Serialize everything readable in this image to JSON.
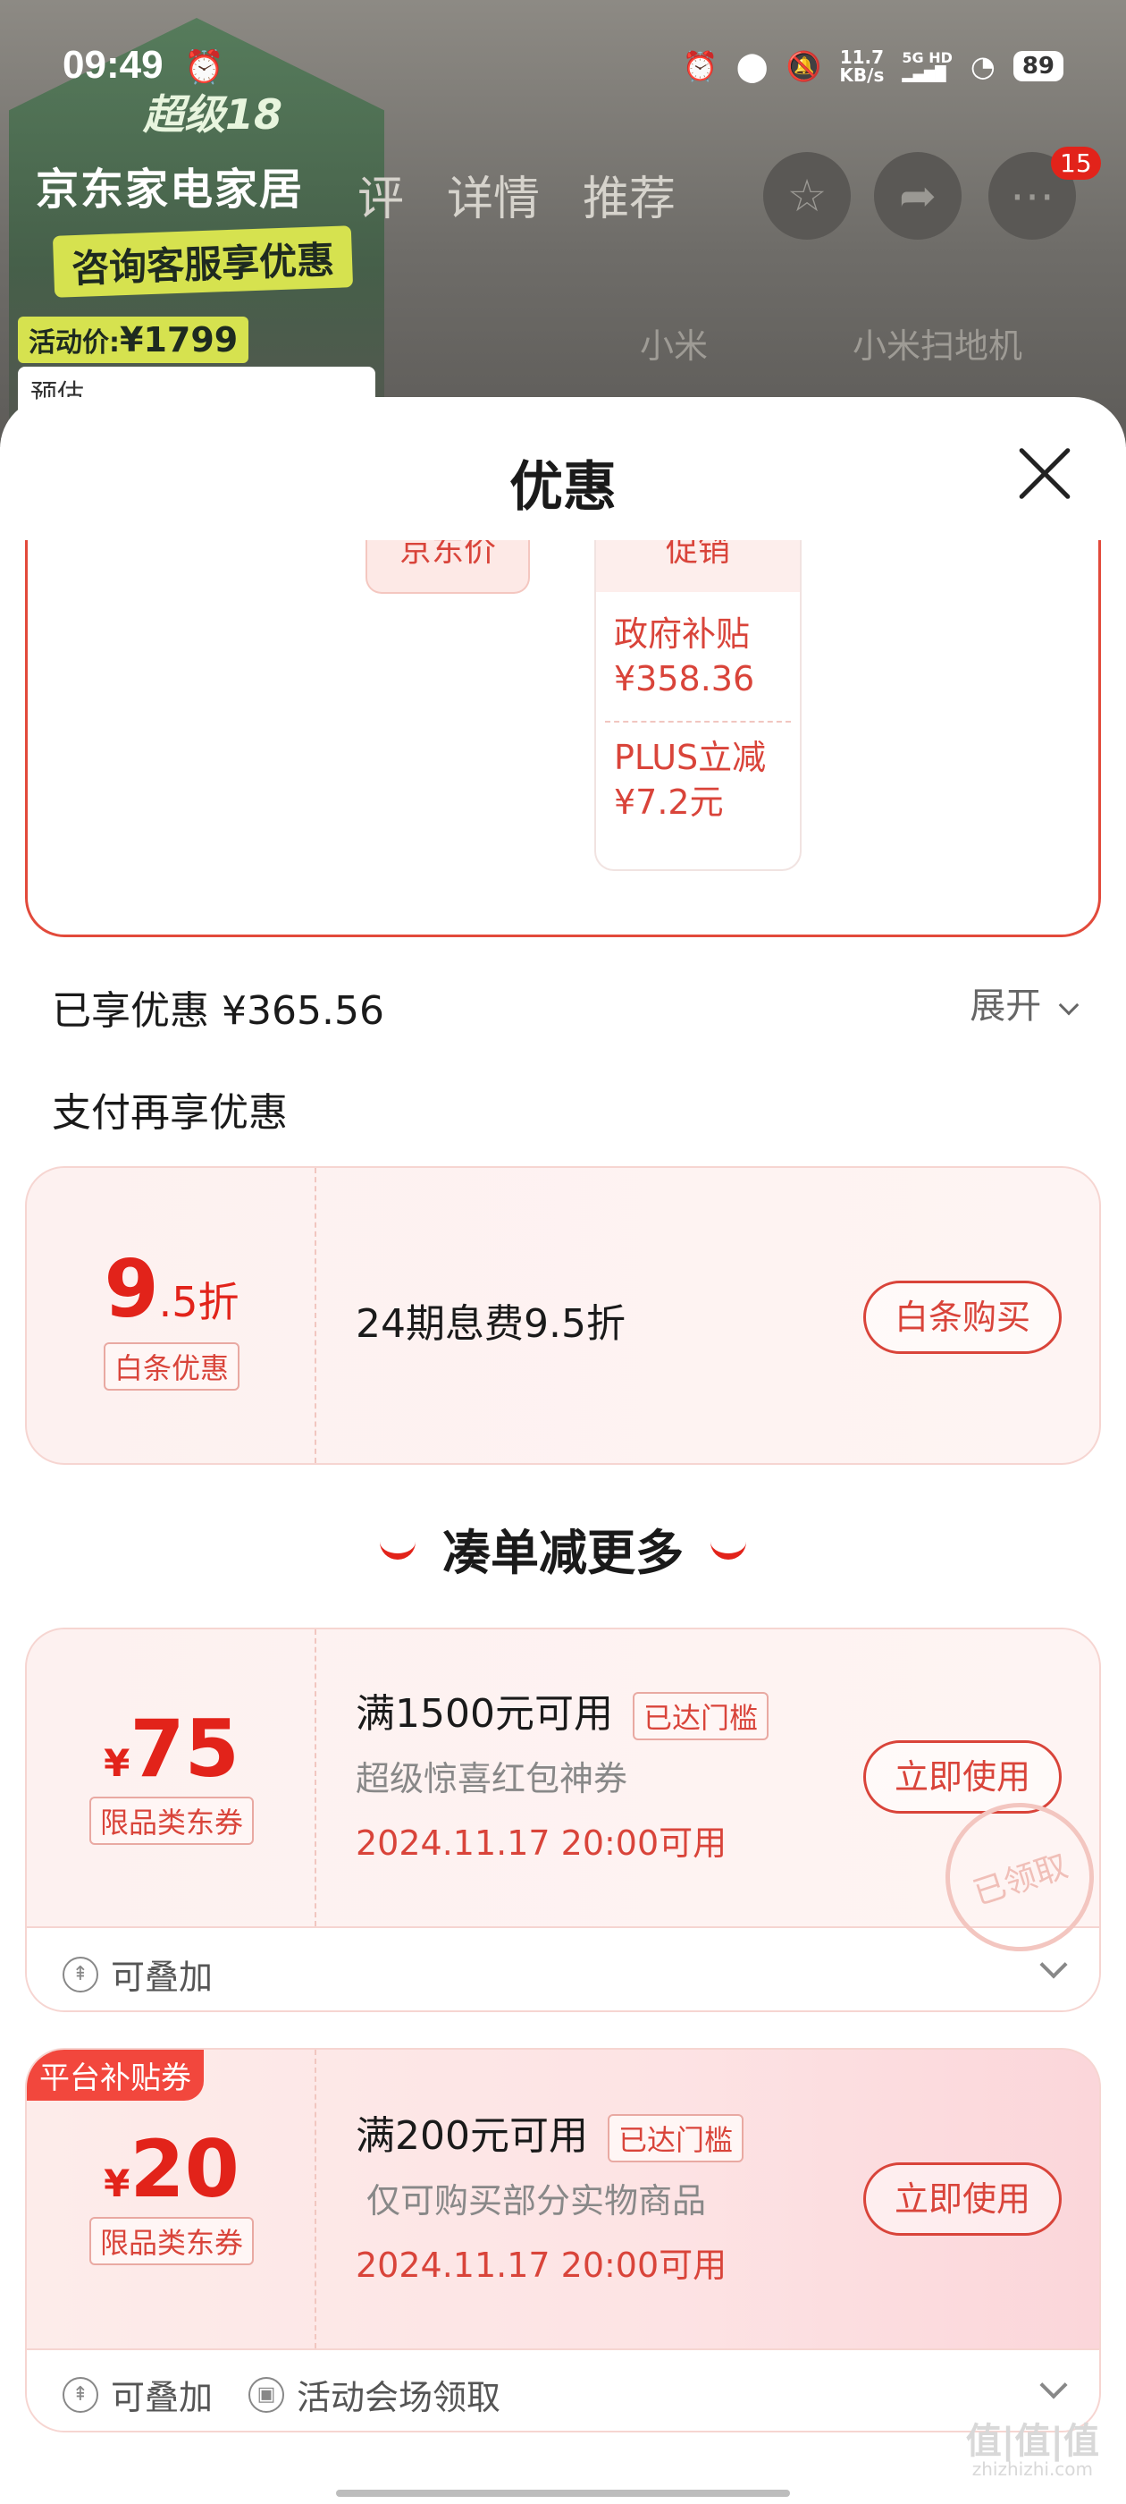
{
  "status_bar": {
    "time": "09:49",
    "speed": "11.7",
    "speed_unit": "KB/s",
    "net_top": "5G HD",
    "battery": "89",
    "icons": [
      "alarm-icon",
      "location-icon",
      "mute-icon",
      "signal-icon",
      "wifi-icon",
      "battery-icon"
    ]
  },
  "background_page": {
    "promo_brand": "超级18",
    "store_name": "京东家电家居",
    "consult_banner": "咨询客服享优惠",
    "activity_price_label": "活动价:",
    "activity_price": "¥1799",
    "estimate_label": "预估",
    "nav_tabs": [
      "评",
      "详情",
      "推荐"
    ],
    "crumb_1": "小米",
    "crumb_2": "小米扫地机",
    "notification_count": "15"
  },
  "sheet": {
    "title": "优惠",
    "price_breakdown": {
      "jd_price_chip": "京东价",
      "promo_header": "促销",
      "items": [
        {
          "name": "政府补贴",
          "amount": "¥358.36"
        },
        {
          "name": "PLUS立减",
          "amount": "¥7.2元"
        }
      ]
    },
    "enjoyed_discount": "已享优惠 ¥365.56",
    "expand_label": "展开",
    "pay_more_title": "支付再享优惠",
    "baitiao_card": {
      "big_number": "9",
      "small_number": ".5折",
      "tag": "白条优惠",
      "description": "24期息费9.5折",
      "button": "白条购买"
    },
    "combine_title": "凑单减更多",
    "coupons": [
      {
        "symbol": "¥",
        "amount": "75",
        "tag": "限品类东券",
        "condition": "满1500元可用",
        "reached": "已达门槛",
        "subtitle": "超级惊喜红包神券",
        "date": "2024.11.17 20:00可用",
        "button": "立即使用",
        "stamp": "已领取",
        "stackable": "可叠加"
      },
      {
        "corner_tag": "平台补贴券",
        "symbol": "¥",
        "amount": "20",
        "tag": "限品类东券",
        "condition": "满200元可用",
        "reached": "已达门槛",
        "subtitle": "仅可购买部分实物商品",
        "date": "2024.11.17 20:00可用",
        "button": "立即使用",
        "stackable": "可叠加",
        "venue": "活动会场领取"
      }
    ]
  },
  "watermark": {
    "main": "值|值|值",
    "sub": "zhizhizhi.com"
  },
  "colors": {
    "accent": "#e2231a",
    "coupon_bg": "#fdf1f0",
    "border": "#f6d5d1"
  }
}
